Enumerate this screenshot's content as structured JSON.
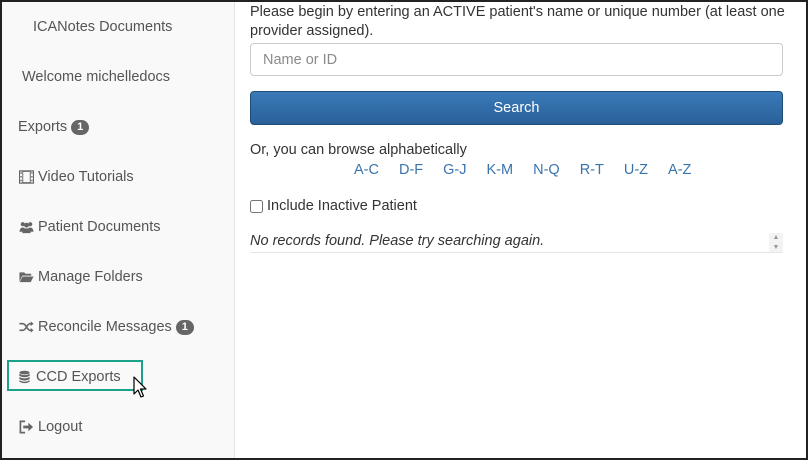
{
  "sidebar": {
    "items": [
      {
        "label": "ICANotes Documents"
      },
      {
        "label": "Welcome michelledocs"
      },
      {
        "label": "Exports",
        "badge": "1"
      },
      {
        "label": "Video Tutorials",
        "icon": "film-icon"
      },
      {
        "label": "Patient Documents",
        "icon": "users-icon"
      },
      {
        "label": "Manage Folders",
        "icon": "folder-open-icon"
      },
      {
        "label": "Reconcile Messages",
        "icon": "random-icon",
        "badge": "1"
      },
      {
        "label": "CCD Exports",
        "icon": "database-icon"
      },
      {
        "label": "Logout",
        "icon": "sign-out-icon"
      }
    ]
  },
  "main": {
    "intro": "Please begin by entering an ACTIVE patient's name or unique number (at least one provider assigned).",
    "search_placeholder": "Name or ID",
    "search_value": "",
    "search_button": "Search",
    "browse_label": "Or, you can browse alphabetically",
    "alpha_links": [
      "A-C",
      "D-F",
      "G-J",
      "K-M",
      "N-Q",
      "R-T",
      "U-Z",
      "A-Z"
    ],
    "include_inactive_label": "Include Inactive Patient",
    "include_inactive_checked": false,
    "no_records": "No records found. Please try searching again."
  },
  "colors": {
    "accent_highlight": "#1aa38a",
    "button_blue": "#2f6ca8",
    "link_blue": "#3a74ad",
    "badge_gray": "#666666"
  }
}
